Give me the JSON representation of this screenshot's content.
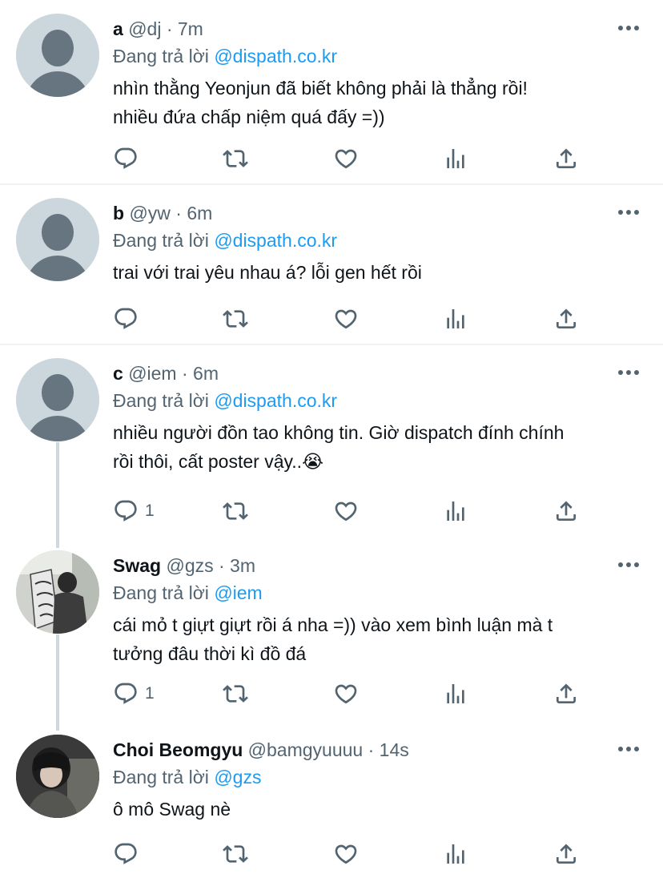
{
  "tweets": [
    {
      "name": "a",
      "meta": "@dj · 7m",
      "replying_prefix": "Đang trả lời ",
      "mention": "@dispath.co.kr",
      "lines": [
        "nhìn thằng Yeonjun đã biết không phải là thẳng rồi!",
        "nhiều đứa chấp niệm quá đấy =))"
      ],
      "reply_count": ""
    },
    {
      "name": "b",
      "meta": "@yw · 6m",
      "replying_prefix": "Đang trả lời ",
      "mention": "@dispath.co.kr",
      "lines": [
        "trai với trai yêu nhau á? lỗi gen hết rồi"
      ],
      "reply_count": ""
    },
    {
      "name": "c",
      "meta": "@iem · 6m",
      "replying_prefix": "Đang trả lời ",
      "mention": "@dispath.co.kr",
      "lines": [
        "nhiều người đồn tao không tin. Giờ dispatch đính chính",
        "rồi thôi, cất poster vậy..😭"
      ],
      "reply_count": "1"
    },
    {
      "name": "Swag",
      "meta": "@gzs · 3m",
      "replying_prefix": "Đang trả lời ",
      "mention": "@iem",
      "lines": [
        "cái mỏ t giựt giựt rồi á nha =)) vào xem bình luận mà t",
        "tưởng đâu thời kì đồ đá"
      ],
      "reply_count": "1"
    },
    {
      "name": "Choi Beomgyu",
      "meta": "@bamgyuuuu · 14s",
      "replying_prefix": "Đang trả lời ",
      "mention": "@gzs",
      "lines": [
        "ô mô Swag nè"
      ],
      "reply_count": ""
    }
  ],
  "icons": {
    "reply": "reply-icon",
    "retweet": "retweet-icon",
    "like": "like-icon",
    "views": "views-icon",
    "share": "share-icon",
    "more": "more-icon"
  },
  "colors": {
    "accent": "#1d9bf0",
    "muted": "#536471",
    "text": "#0f1419",
    "divider": "#eff3f4"
  }
}
